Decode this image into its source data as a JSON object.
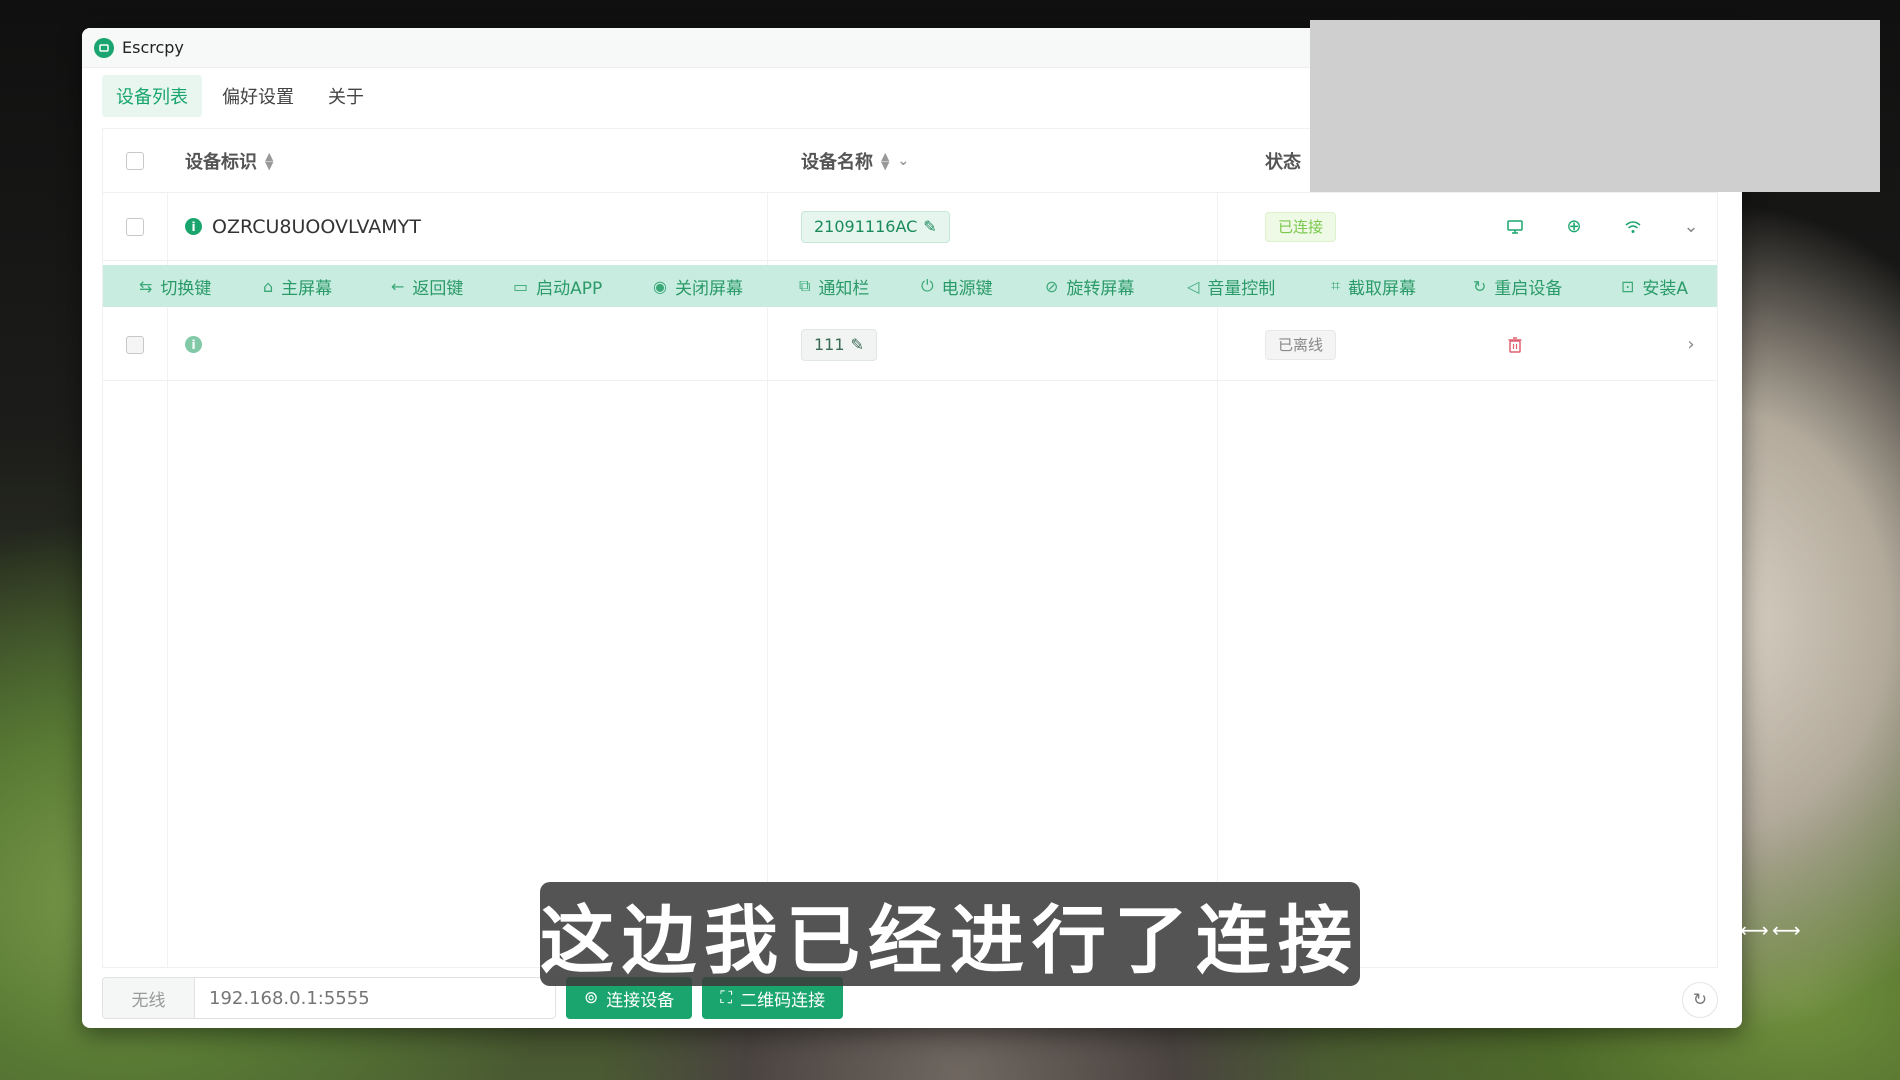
{
  "window": {
    "title": "Escrcpy"
  },
  "tabs": [
    {
      "label": "设备列表",
      "active": true
    },
    {
      "label": "偏好设置",
      "active": false
    },
    {
      "label": "关于",
      "active": false
    }
  ],
  "table": {
    "headers": {
      "serial": "设备标识",
      "name": "设备名称",
      "status": "状态"
    },
    "rows": [
      {
        "serial": "OZRCU8UOOVLVAMYT",
        "name": "21091116AC",
        "status": "已连接",
        "icon": "i"
      },
      {
        "serial": "",
        "name": "111",
        "status": "已离线",
        "icon": "i"
      }
    ]
  },
  "ops": [
    {
      "icon": "⇆",
      "label": "切换键"
    },
    {
      "icon": "⌂",
      "label": "主屏幕"
    },
    {
      "icon": "←",
      "label": "返回键"
    },
    {
      "icon": "▭",
      "label": "启动APP"
    },
    {
      "icon": "◉",
      "label": "关闭屏幕"
    },
    {
      "icon": "⧉",
      "label": "通知栏"
    },
    {
      "icon": "⏻",
      "label": "电源键"
    },
    {
      "icon": "⊘",
      "label": "旋转屏幕"
    },
    {
      "icon": "◁",
      "label": "音量控制"
    },
    {
      "icon": "⌗",
      "label": "截取屏幕"
    },
    {
      "icon": "↻",
      "label": "重启设备"
    },
    {
      "icon": "⊡",
      "label": "安装A"
    }
  ],
  "bottom": {
    "addon": "无线",
    "placeholder": "192.168.0.1:5555",
    "connect_label": "连接设备",
    "qr_label": "二维码连接"
  },
  "caption": "这边我已经进行了连接",
  "colors": {
    "accent": "#1aa56e",
    "ops_bg": "#c9ece0",
    "connected": "#7ac84c",
    "delete": "#e06070"
  }
}
